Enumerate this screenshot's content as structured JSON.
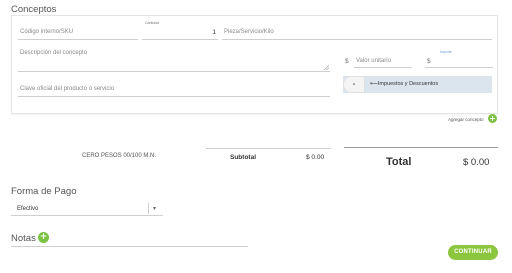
{
  "conceptos": {
    "title": "Conceptos",
    "sku_placeholder": "Código interno/SKU",
    "cantidad_label": "Cantidad",
    "cantidad_value": "1",
    "unidad_placeholder": "Pieza/Servicio/Kilo",
    "descripcion_placeholder": "Descripción del concepto",
    "currency_symbol": "$",
    "valor_unitario_placeholder": "Valor unitario",
    "importe_label": "Importe",
    "clave_placeholder": "Clave oficial del producto o servicio",
    "toggle_label": "-",
    "impuestos_label": "⟵Impuestos y Descuentos",
    "agregar_label": "Agregar concepto",
    "add_icon": "+"
  },
  "totals": {
    "amount_words": "CERO PESOS 00/100 M.N.",
    "subtotal_label": "Subtotal",
    "subtotal_value": "$ 0.00",
    "total_label": "Total",
    "total_value": "$ 0.00"
  },
  "pago": {
    "title": "Forma de Pago",
    "selected": "Efectivo",
    "caret": "▾"
  },
  "notas": {
    "title": "Notas",
    "add_icon": "+"
  },
  "footer": {
    "continuar_label": "CONTINUAR"
  },
  "colors": {
    "accent_green": "#8cc63f",
    "impuestos_bg": "#dbe5ee"
  }
}
